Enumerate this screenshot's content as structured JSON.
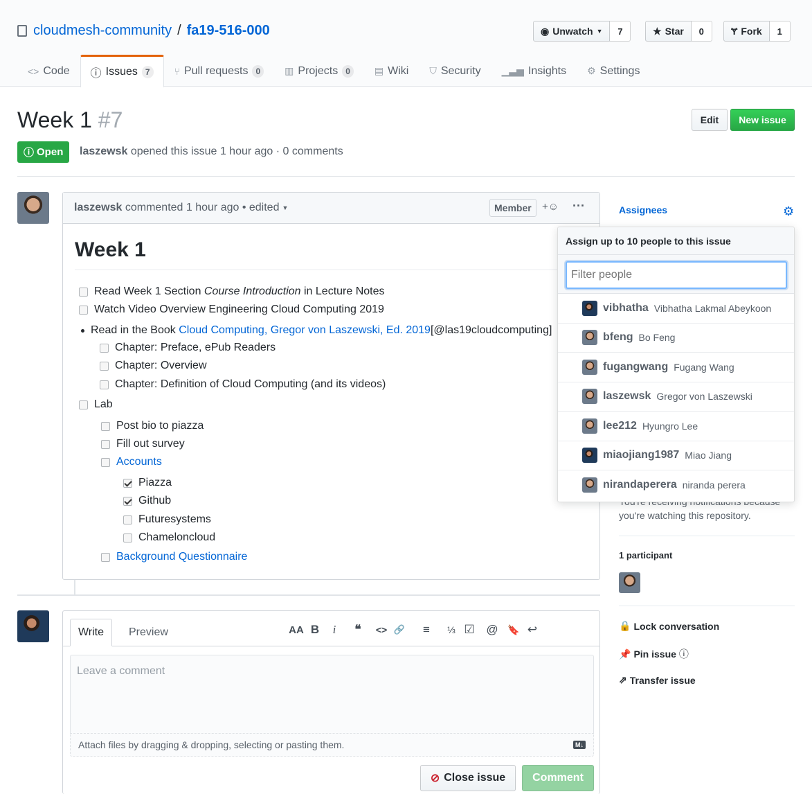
{
  "repo": {
    "owner": "cloudmesh-community",
    "separator": "/",
    "name": "fa19-516-000"
  },
  "actions": [
    {
      "label": "Unwatch",
      "count": "7",
      "icon": "eye-icon"
    },
    {
      "label": "Star",
      "count": "0",
      "icon": "star-icon"
    },
    {
      "label": "Fork",
      "count": "1",
      "icon": "fork-icon"
    }
  ],
  "nav": [
    {
      "label": "Code",
      "icon": "code-icon",
      "counter": null
    },
    {
      "label": "Issues",
      "icon": "issue-icon",
      "counter": "7"
    },
    {
      "label": "Pull requests",
      "icon": "pull-request-icon",
      "counter": "0"
    },
    {
      "label": "Projects",
      "icon": "project-icon",
      "counter": "0"
    },
    {
      "label": "Wiki",
      "icon": "book-icon",
      "counter": null
    },
    {
      "label": "Security",
      "icon": "shield-icon",
      "counter": null
    },
    {
      "label": "Insights",
      "icon": "graph-icon",
      "counter": null
    },
    {
      "label": "Settings",
      "icon": "gear-icon",
      "counter": null
    }
  ],
  "issue": {
    "title": "Week 1",
    "number": "#7",
    "state": "Open",
    "author": "laszewsk",
    "meta": "opened this issue 1 hour ago · 0 comments",
    "edit_label": "Edit",
    "new_label": "New issue"
  },
  "comment": {
    "author": "laszewsk",
    "meta": "commented 1 hour ago • edited",
    "role": "Member",
    "reaction": "+☺",
    "menu": "···",
    "heading": "Week 1",
    "tasks": {
      "t1_pre": "Read Week 1 Section ",
      "t1_em": "Course Introduction",
      "t1_post": " in Lecture Notes",
      "t2": "Watch Video Overview Engineering Cloud Computing 2019",
      "t3_pre": "Read in the Book ",
      "t3_link": "Cloud Computing, Gregor von Laszewski, Ed. 2019",
      "t3_post": "[@las19cloudcomputing]",
      "t4": "Chapter: Preface, ePub Readers",
      "t5": "Chapter: Overview",
      "t6": "Chapter: Definition of Cloud Computing (and its videos)",
      "t7": "Lab",
      "t8": "Post bio to piazza",
      "t9": "Fill out survey",
      "t10": "Accounts",
      "t11": "Piazza",
      "t12": "Github",
      "t13": "Futuresystems",
      "t14": "Chameloncloud",
      "t15": "Background Questionnaire"
    }
  },
  "form": {
    "tab_write": "Write",
    "tab_preview": "Preview",
    "toolbar": [
      "AA",
      "B",
      "i",
      "❝",
      "<>",
      "🔗",
      "≡",
      "⅓",
      "☑",
      "@",
      "🔖",
      "↩"
    ],
    "placeholder": "Leave a comment",
    "attach": "Attach files by dragging & dropping, selecting or pasting them.",
    "md": "M↓",
    "close_label": "Close issue",
    "comment_label": "Comment"
  },
  "sidebar": {
    "assignees": "Assignees",
    "notifications": "you're watching this repository.",
    "notifications_cut": "You're receiving notifications because",
    "participants": "1 participant",
    "lock": "Lock conversation",
    "pin": "Pin issue",
    "transfer": "Transfer issue"
  },
  "popover": {
    "title": "Assign up to 10 people to this issue",
    "filter_placeholder": "Filter people",
    "people": [
      {
        "login": "vibhatha",
        "name": "Vibhatha Lakmal Abeykoon"
      },
      {
        "login": "bfeng",
        "name": "Bo Feng"
      },
      {
        "login": "fugangwang",
        "name": "Fugang Wang"
      },
      {
        "login": "laszewsk",
        "name": "Gregor von Laszewski"
      },
      {
        "login": "lee212",
        "name": "Hyungro Lee"
      },
      {
        "login": "miaojiang1987",
        "name": "Miao Jiang"
      },
      {
        "login": "nirandaperera",
        "name": "niranda perera"
      }
    ]
  }
}
